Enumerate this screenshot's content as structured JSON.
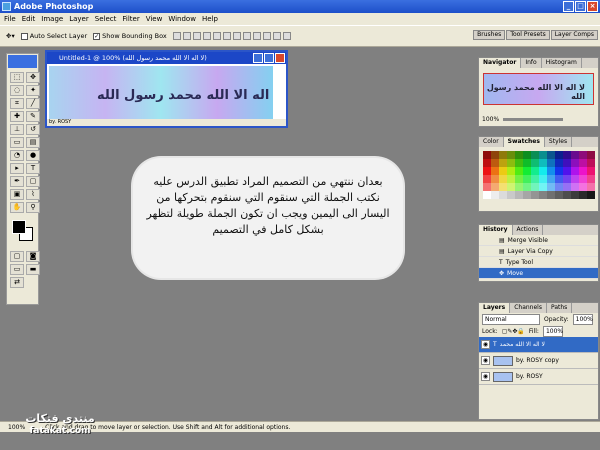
{
  "app": {
    "title": "Adobe Photoshop"
  },
  "menu": [
    "File",
    "Edit",
    "Image",
    "Layer",
    "Select",
    "Filter",
    "View",
    "Window",
    "Help"
  ],
  "options": {
    "auto_select": "Auto Select Layer",
    "show_bounding": "Show Bounding Box"
  },
  "palette_well": [
    "Brushes",
    "Tool Presets",
    "Layer Comps"
  ],
  "document": {
    "title": "Untitled-1 @ 100% (لا اله الا الله محمد رسول الله)",
    "canvas_text": "لا اله الا الله محمد رسول الله",
    "footer": "by. ROSY"
  },
  "note": "بعدان ننتهي من التصميم المراد تطبيق الدرس عليه نكتب الجملة التي سنقوم التي سنقوم بتحركها من اليسار الى اليمين ويجب ان تكون الجملة طويلة لتظهر بشكل كامل في التصميم",
  "navigator": {
    "tabs": [
      "Navigator",
      "Info",
      "Histogram"
    ],
    "preview_text": "لا اله الا الله محمد رسول الله",
    "zoom": "100%"
  },
  "color_panel": {
    "tabs": [
      "Color",
      "Swatches",
      "Styles"
    ]
  },
  "history": {
    "tabs": [
      "History",
      "Actions"
    ],
    "items": [
      "Merge Visible",
      "Layer Via Copy",
      "Type Tool",
      "Move"
    ]
  },
  "layers": {
    "tabs": [
      "Layers",
      "Channels",
      "Paths"
    ],
    "blend": "Normal",
    "opacity_label": "Opacity:",
    "opacity": "100%",
    "lock_label": "Lock:",
    "fill_label": "Fill:",
    "fill": "100%",
    "rows": [
      "لا اله الا الله محمد",
      "by. ROSY copy",
      "by. ROSY"
    ]
  },
  "status": {
    "zoom": "100%",
    "text": "Click and drag to move layer or selection.  Use Shift and Alt for additional options."
  },
  "watermark": {
    "arabic": "منتدى فتكات",
    "latin": "fatakat.com"
  },
  "colors": {
    "accent": "#316ac5",
    "title": "#1c47c7"
  }
}
